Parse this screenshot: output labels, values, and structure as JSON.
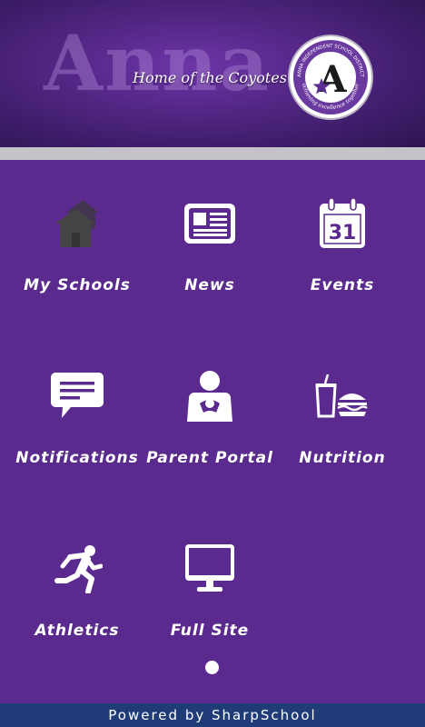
{
  "header": {
    "watermark": "Anna",
    "tagline": "Home of the Coyotes",
    "seal_top_text": "ANNA INDEPENDENT SCHOOL DISTRICT",
    "seal_bottom_text": "achieving excellence together",
    "seal_letter": "A"
  },
  "menu": [
    {
      "label": "My Schools",
      "icon": "house-icon"
    },
    {
      "label": "News",
      "icon": "newspaper-icon"
    },
    {
      "label": "Events",
      "icon": "calendar-icon",
      "icon_text": "31"
    },
    {
      "label": "Notifications",
      "icon": "chat-bubble-icon"
    },
    {
      "label": "Parent Portal",
      "icon": "parent-icon"
    },
    {
      "label": "Nutrition",
      "icon": "food-icon"
    },
    {
      "label": "Athletics",
      "icon": "runner-icon"
    },
    {
      "label": "Full Site",
      "icon": "monitor-icon"
    }
  ],
  "pager": {
    "current_page": 1,
    "page_count": 1
  },
  "footer": {
    "text": "Powered by SharpSchool"
  },
  "colors": {
    "background": "#5b2a8e",
    "footer": "#1f3c78",
    "divider": "#c6c2c9"
  }
}
